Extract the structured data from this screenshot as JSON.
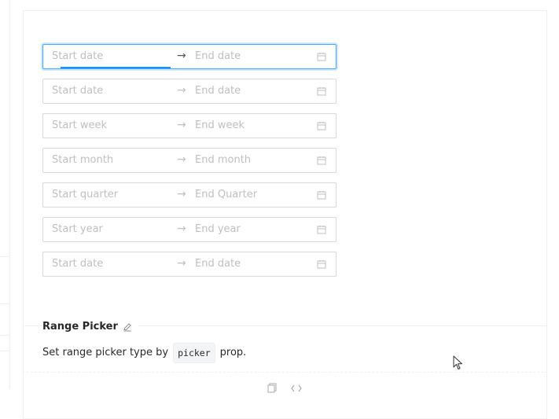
{
  "pickers": [
    {
      "start_placeholder": "Start date",
      "end_placeholder": "End date",
      "focused": true
    },
    {
      "start_placeholder": "Start date",
      "end_placeholder": "End date",
      "focused": false
    },
    {
      "start_placeholder": "Start week",
      "end_placeholder": "End week",
      "focused": false
    },
    {
      "start_placeholder": "Start month",
      "end_placeholder": "End month",
      "focused": false
    },
    {
      "start_placeholder": "Start quarter",
      "end_placeholder": "End Quarter",
      "focused": false
    },
    {
      "start_placeholder": "Start year",
      "end_placeholder": "End year",
      "focused": false
    },
    {
      "start_placeholder": "Start date",
      "end_placeholder": "End date",
      "focused": false
    }
  ],
  "separator": "→",
  "meta": {
    "title": "Range Picker",
    "desc_prefix": "Set range picker type by",
    "desc_code": "picker",
    "desc_suffix": "prop."
  },
  "icons": {
    "calendar": "calendar-icon",
    "edit": "edit-icon",
    "copy": "copy-icon",
    "code": "code-icon"
  },
  "colors": {
    "focus_border": "#40a9ff",
    "active_bar": "#1890ff",
    "placeholder": "#bfbfbf",
    "border": "#d9d9d9"
  }
}
